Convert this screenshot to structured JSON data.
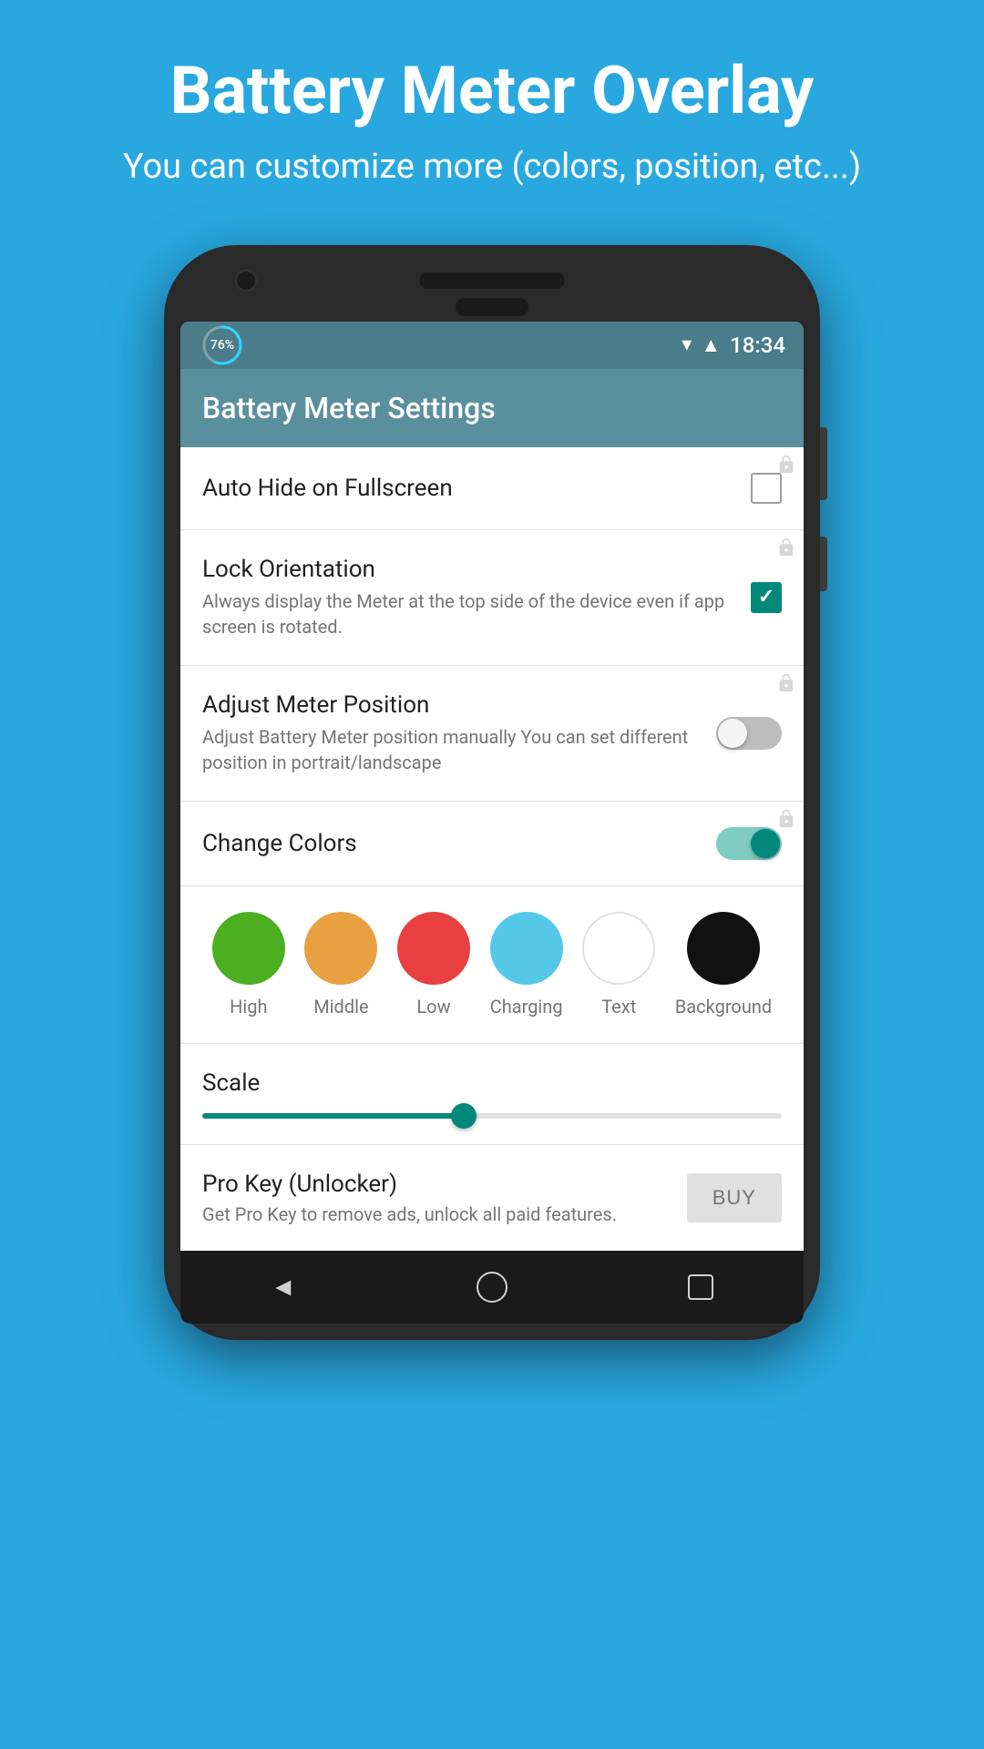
{
  "header": {
    "title": "Battery Meter Overlay",
    "subtitle": "You can customize more (colors, position, etc...)"
  },
  "status_bar": {
    "battery_percent": "76%",
    "time": "18:34"
  },
  "toolbar": {
    "title": "Battery Meter Settings"
  },
  "settings": [
    {
      "id": "auto_hide",
      "label": "Auto Hide on Fullscreen",
      "description": "",
      "control": "checkbox",
      "checked": false
    },
    {
      "id": "lock_orientation",
      "label": "Lock Orientation",
      "description": "Always display the Meter at the top side of the device even if app screen is rotated.",
      "control": "checkbox",
      "checked": true
    },
    {
      "id": "adjust_position",
      "label": "Adjust Meter Position",
      "description": "Adjust Battery Meter position manually You can set different position in portrait/landscape",
      "control": "toggle",
      "enabled": false
    },
    {
      "id": "change_colors",
      "label": "Change Colors",
      "description": "",
      "control": "toggle",
      "enabled": true
    }
  ],
  "colors": [
    {
      "id": "high",
      "label": "High",
      "color": "#4caf22"
    },
    {
      "id": "middle",
      "label": "Middle",
      "color": "#e8a040"
    },
    {
      "id": "low",
      "label": "Low",
      "color": "#e84040"
    },
    {
      "id": "charging",
      "label": "Charging",
      "color": "#55c8e8"
    },
    {
      "id": "text",
      "label": "Text",
      "color": "#ffffff"
    },
    {
      "id": "background",
      "label": "Background",
      "color": "#111111"
    }
  ],
  "scale": {
    "label": "Scale",
    "value": 45
  },
  "pro_key": {
    "title": "Pro Key (Unlocker)",
    "description": "Get Pro Key to remove ads, unlock all paid features.",
    "buy_label": "BUY"
  },
  "nav": {
    "back_label": "◄",
    "home_label": "",
    "recent_label": ""
  }
}
